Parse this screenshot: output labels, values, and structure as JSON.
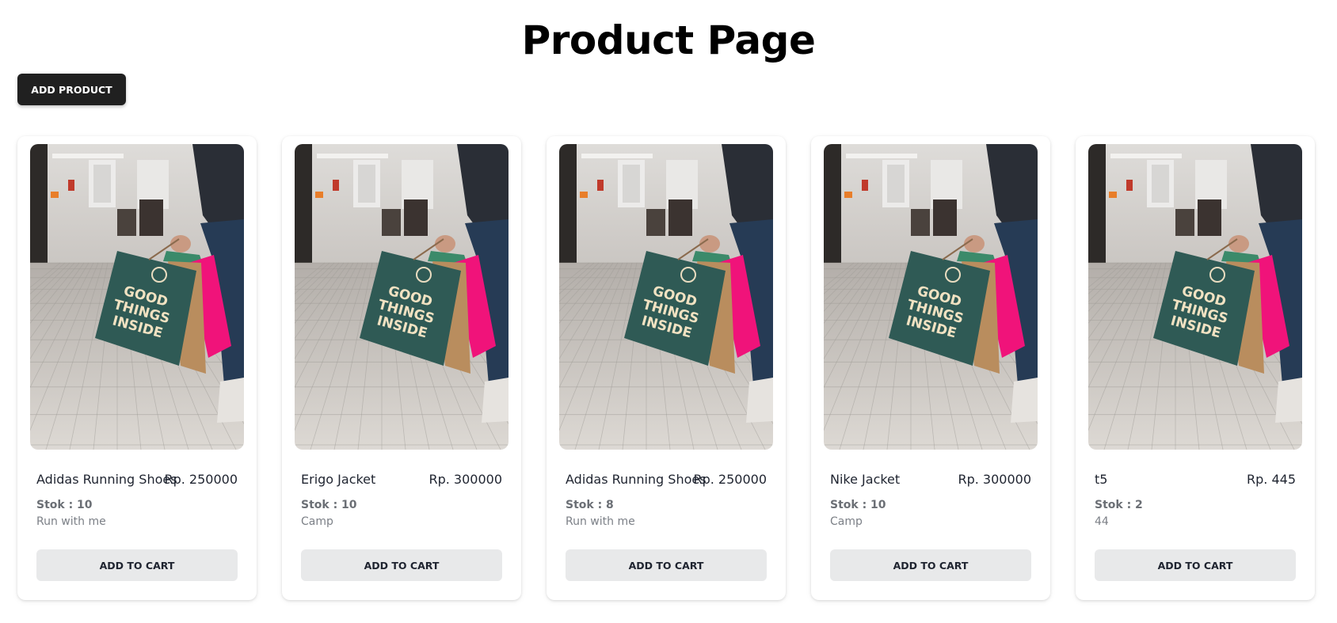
{
  "page": {
    "title": "Product Page",
    "add_product_label": "ADD PRODUCT"
  },
  "products": [
    {
      "name": "Adidas Running Shoes",
      "price": "Rp. 250000",
      "stock": "Stok : 10",
      "description": "Run with me",
      "cta": "ADD TO CART",
      "image_alt": "Person carrying shopping bags"
    },
    {
      "name": "Erigo Jacket",
      "price": "Rp. 300000",
      "stock": "Stok : 10",
      "description": "Camp",
      "cta": "ADD TO CART",
      "image_alt": "Person carrying shopping bags"
    },
    {
      "name": "Adidas Running Shoes",
      "price": "Rp. 250000",
      "stock": "Stok : 8",
      "description": "Run with me",
      "cta": "ADD TO CART",
      "image_alt": "Person carrying shopping bags"
    },
    {
      "name": "Nike Jacket",
      "price": "Rp. 300000",
      "stock": "Stok : 10",
      "description": "Camp",
      "cta": "ADD TO CART",
      "image_alt": "Person carrying shopping bags"
    },
    {
      "name": "t5",
      "price": "Rp. 445",
      "stock": "Stok : 2",
      "description": "44",
      "cta": "ADD TO CART",
      "image_alt": "Person carrying shopping bags"
    }
  ],
  "image_text": {
    "bag_line1": "GOOD",
    "bag_line2": "THINGS",
    "bag_line3": "INSIDE"
  },
  "colors": {
    "primary_button": "#202020",
    "secondary_button": "#e8e9ea",
    "bag_green": "#2f5a55",
    "bag_pink": "#f0137a",
    "bag_kraft": "#b98d5e"
  }
}
